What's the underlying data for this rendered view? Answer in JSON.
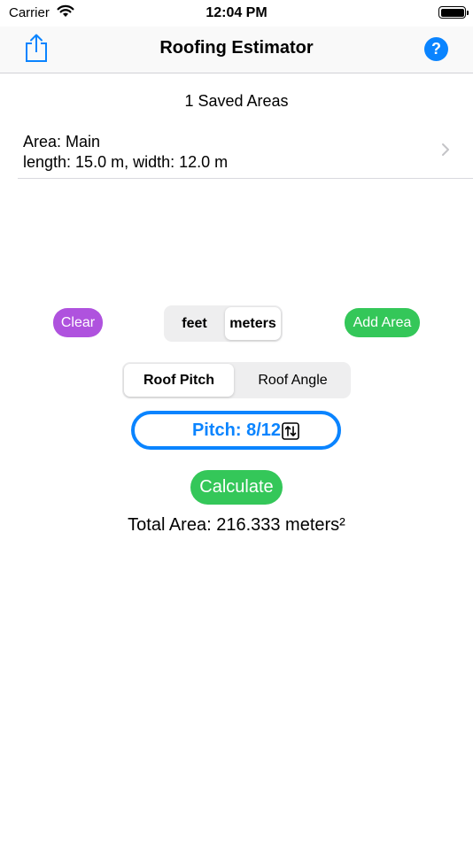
{
  "status_bar": {
    "carrier": "Carrier",
    "time": "12:04 PM"
  },
  "nav": {
    "title": "Roofing Estimator",
    "help_label": "?"
  },
  "saved": {
    "header": "1 Saved Areas",
    "items": [
      {
        "name": "Area: Main",
        "dimensions": "length: 15.0 m, width: 12.0 m"
      }
    ]
  },
  "controls": {
    "clear_label": "Clear",
    "add_area_label": "Add Area",
    "units": {
      "options": [
        "feet",
        "meters"
      ],
      "selected": "meters"
    },
    "modes": {
      "options": [
        "Roof Pitch",
        "Roof Angle"
      ],
      "selected": "Roof Pitch"
    },
    "pitch_label": "Pitch: 8/12",
    "calculate_label": "Calculate"
  },
  "result": {
    "total_text": "Total Area: 216.333 meters²"
  },
  "colors": {
    "accent_blue": "#0a84ff",
    "green": "#34c759",
    "purple": "#af52de"
  }
}
